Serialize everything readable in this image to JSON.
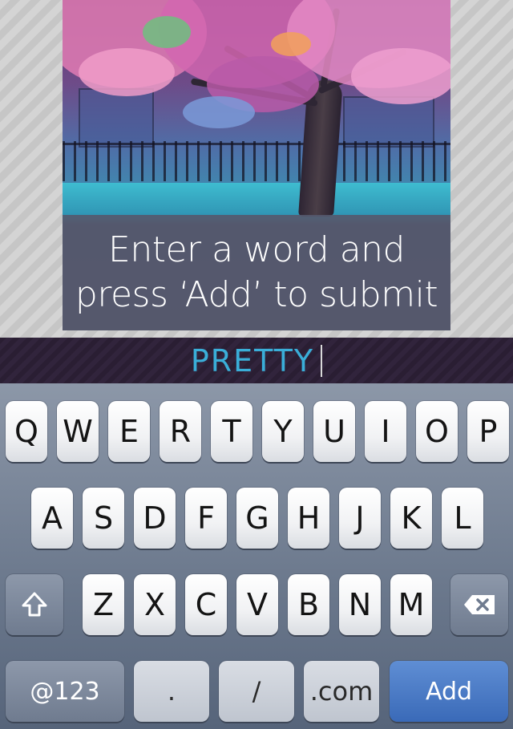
{
  "banner": {
    "instruction": "Enter a word and press ‘Add’ to submit"
  },
  "word_input": {
    "value": "PRETTY",
    "color": "#3aaed8"
  },
  "keyboard": {
    "row1": [
      "Q",
      "W",
      "E",
      "R",
      "T",
      "Y",
      "U",
      "I",
      "O",
      "P"
    ],
    "row2": [
      "A",
      "S",
      "D",
      "F",
      "G",
      "H",
      "J",
      "K",
      "L"
    ],
    "row3": [
      "Z",
      "X",
      "C",
      "V",
      "B",
      "N",
      "M"
    ],
    "shift_icon": "shift-icon",
    "delete_icon": "backspace-icon",
    "numbers_label": "@123",
    "period_label": ".",
    "slash_label": "/",
    "dotcom_label": ".com",
    "add_label": "Add",
    "add_color": "#3a6ab8"
  }
}
